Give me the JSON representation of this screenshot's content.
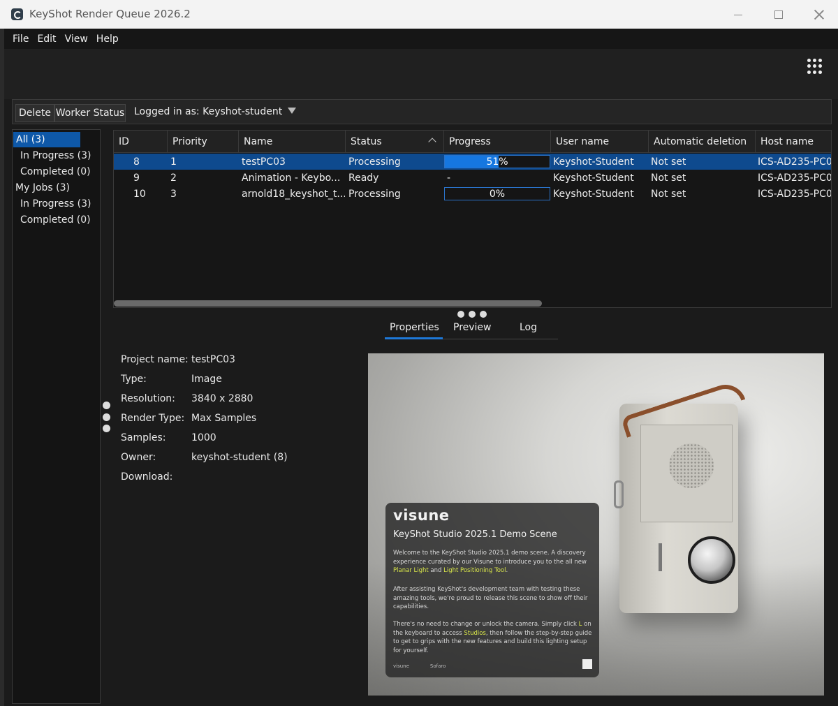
{
  "window": {
    "title": "KeyShot Render Queue 2026.2"
  },
  "menu": [
    "File",
    "Edit",
    "View",
    "Help"
  ],
  "toolbar": {
    "delete_label": "Delete",
    "worker_status_label": "Worker Status",
    "logged_in": "Logged in as: Keyshot-student"
  },
  "sidebar": {
    "items": [
      "All (3)",
      "In Progress (3)",
      "Completed (0)",
      "My Jobs (3)",
      "In Progress (3)",
      "Completed (0)"
    ]
  },
  "table": {
    "columns": [
      "ID",
      "Priority",
      "Name",
      "Status",
      "Progress",
      "User name",
      "Automatic deletion",
      "Host name"
    ],
    "rows": [
      {
        "id": "8",
        "priority": "1",
        "name": "testPC03",
        "status": "Processing",
        "progress_label": "51%",
        "progress_value": 51,
        "user": "Keyshot-Student",
        "auto_delete": "Not set",
        "host": "ICS-AD235-PC0"
      },
      {
        "id": "9",
        "priority": "2",
        "name": "Animation - Keybo...",
        "status": "Ready",
        "progress_label": "-",
        "progress_value": null,
        "user": "Keyshot-Student",
        "auto_delete": "Not set",
        "host": "ICS-AD235-PC0"
      },
      {
        "id": "10",
        "priority": "3",
        "name": "arnold18_keyshot_t...",
        "status": "Processing",
        "progress_label": "0%",
        "progress_value": 0,
        "user": "Keyshot-Student",
        "auto_delete": "Not set",
        "host": "ICS-AD235-PC0"
      }
    ]
  },
  "tabs": [
    "Properties",
    "Preview",
    "Log"
  ],
  "properties": {
    "labels": [
      "Project name:",
      "Type:",
      "Resolution:",
      "Render Type:",
      "Samples:",
      "Owner:",
      "Download:"
    ],
    "values": [
      "testPC03",
      "Image",
      "3840 x 2880",
      "Max Samples",
      "1000",
      "keyshot-student (8)",
      ""
    ]
  },
  "preview_card": {
    "brand": "visune",
    "title": "KeyShot Studio 2025.1 Demo Scene",
    "para1_a": "Welcome to the KeyShot Studio 2025.1 demo scene. A discovery experience curated by our Visune to introduce you to the all new ",
    "para1_hl1": "Planar Light",
    "para1_b": " and ",
    "para1_hl2": "Light Positioning Tool",
    "para1_c": ".",
    "para2": "After assisting KeyShot's development team with testing these amazing tools, we're proud to release this scene to show off their capabilities.",
    "para3_a": "There's no need to change or unlock the camera. Simply click ",
    "para3_hl1": "L",
    "para3_b": " on the keyboard to access ",
    "para3_hl2": "Studios",
    "para3_c": ", then follow the step-by-step guide to get to grips with the new features and build this lighting setup for yourself.",
    "footer_left": "visune",
    "footer_right": "Sofaro"
  },
  "colors": {
    "accent": "#1677e0",
    "selection": "#0e4a8e",
    "highlight": "#d9e64a"
  }
}
